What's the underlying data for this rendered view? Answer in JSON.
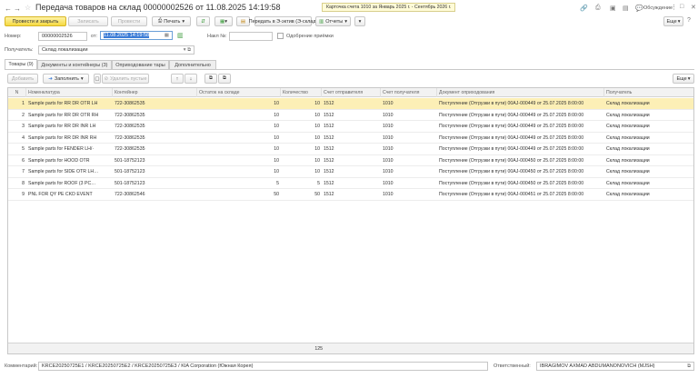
{
  "title": "Передача товаров на склад 00000002526 от 11.08.2025 14:19:58",
  "tooltip": "Карточка счета 1010 за Январь 2025 г. - Сентябрь 2026 г.",
  "top_right": {
    "discussions": "Обсуждение"
  },
  "toolbar": {
    "post_close": "Провести и закрыть",
    "save": "Записать",
    "post": "Провести",
    "print": "Печать",
    "transfer": "Передать в Э-эктив (Э-склад)",
    "reports": "Отчеты",
    "more": "Еще"
  },
  "header": {
    "number_label": "Номер:",
    "number_value": "00000002526",
    "date_label": "от:",
    "date_value": "11.08.2025 14:19:58",
    "invoice_label": "Накл №:",
    "invoice_value": "",
    "accept_label": "Одобрение приёмки",
    "recipient_label": "Получатель:",
    "recipient_value": "Склад локализации"
  },
  "tabs": [
    {
      "label": "Товары (9)"
    },
    {
      "label": "Документы и контейнеры (3)"
    },
    {
      "label": "Оприходование тары"
    },
    {
      "label": "Дополнительно"
    }
  ],
  "grid_toolbar": {
    "add": "Добавить",
    "fill": "Заполнить",
    "delete_empty": "Удалить пустые",
    "more": "Еще"
  },
  "columns": [
    "N",
    "Номенклатура",
    "Контейнер",
    "Остаток на складе",
    "Количество",
    "Счет отправителя",
    "Счет получателя",
    "Документ оприходования",
    "Получатель"
  ],
  "rows": [
    [
      "1",
      "Sample parts for RR DR OTR LH",
      "722-30862535",
      "10",
      "10",
      "1512",
      "1010",
      "Поступление (Отгрузки в пути) 00AJ-000449 от 25.07.2025 8:00:00",
      "Склад локализации"
    ],
    [
      "2",
      "Sample parts for RR DR OTR RH",
      "722-30862535",
      "10",
      "10",
      "1512",
      "1010",
      "Поступление (Отгрузки в пути) 00AJ-000449 от 25.07.2025 8:00:00",
      "Склад локализации"
    ],
    [
      "3",
      "Sample parts for RR DR INR LH",
      "722-30862535",
      "10",
      "10",
      "1512",
      "1010",
      "Поступление (Отгрузки в пути) 00AJ-000449 от 25.07.2025 8:00:00",
      "Склад локализации"
    ],
    [
      "4",
      "Sample parts for RR DR INR RH",
      "722-30862535",
      "10",
      "10",
      "1512",
      "1010",
      "Поступление (Отгрузки в пути) 00AJ-000449 от 25.07.2025 8:00:00",
      "Склад локализации"
    ],
    [
      "5",
      "Sample parts for FENDER LH/·",
      "722-30862535",
      "10",
      "10",
      "1512",
      "1010",
      "Поступление (Отгрузки в пути) 00AJ-000449 от 25.07.2025 8:00:00",
      "Склад локализации"
    ],
    [
      "6",
      "Sample parts for HOOD OTR",
      "501-18752123",
      "10",
      "10",
      "1512",
      "1010",
      "Поступление (Отгрузки в пути) 00AJ-000450 от 25.07.2025 8:00:00",
      "Склад локализации"
    ],
    [
      "7",
      "Sample parts for SIDE OTR LH…",
      "501-18752123",
      "10",
      "10",
      "1512",
      "1010",
      "Поступление (Отгрузки в пути) 00AJ-000450 от 25.07.2025 8:00:00",
      "Склад локализации"
    ],
    [
      "8",
      "Sample parts for ROOF (3 PC…",
      "501-18752123",
      "5",
      "5",
      "1512",
      "1010",
      "Поступление (Отгрузки в пути) 00AJ-000450 от 25.07.2025 8:00:00",
      "Склад локализации"
    ],
    [
      "9",
      "PNL FOR QY PE CKD EVENT",
      "722-30862546",
      "50",
      "50",
      "1512",
      "1010",
      "Поступление (Отгрузки в пути) 00AJ-000451 от 25.07.2025 8:00:00",
      "Склад локализации"
    ]
  ],
  "total_quantity": "125",
  "footer": {
    "comment_label": "Комментарий:",
    "comment_value": "KRCE20250725E1 / KRCE20250725E2 / KRCE20250725E3 / KIA Corporation (Южная Корея)",
    "responsible_label": "Ответственный:",
    "responsible_value": "IBRAGIMOV AXMAD ABDUMANONOVICH (MJSH)"
  },
  "colors": {
    "accent": "#f5d940",
    "selected_row": "#fcefb6"
  }
}
